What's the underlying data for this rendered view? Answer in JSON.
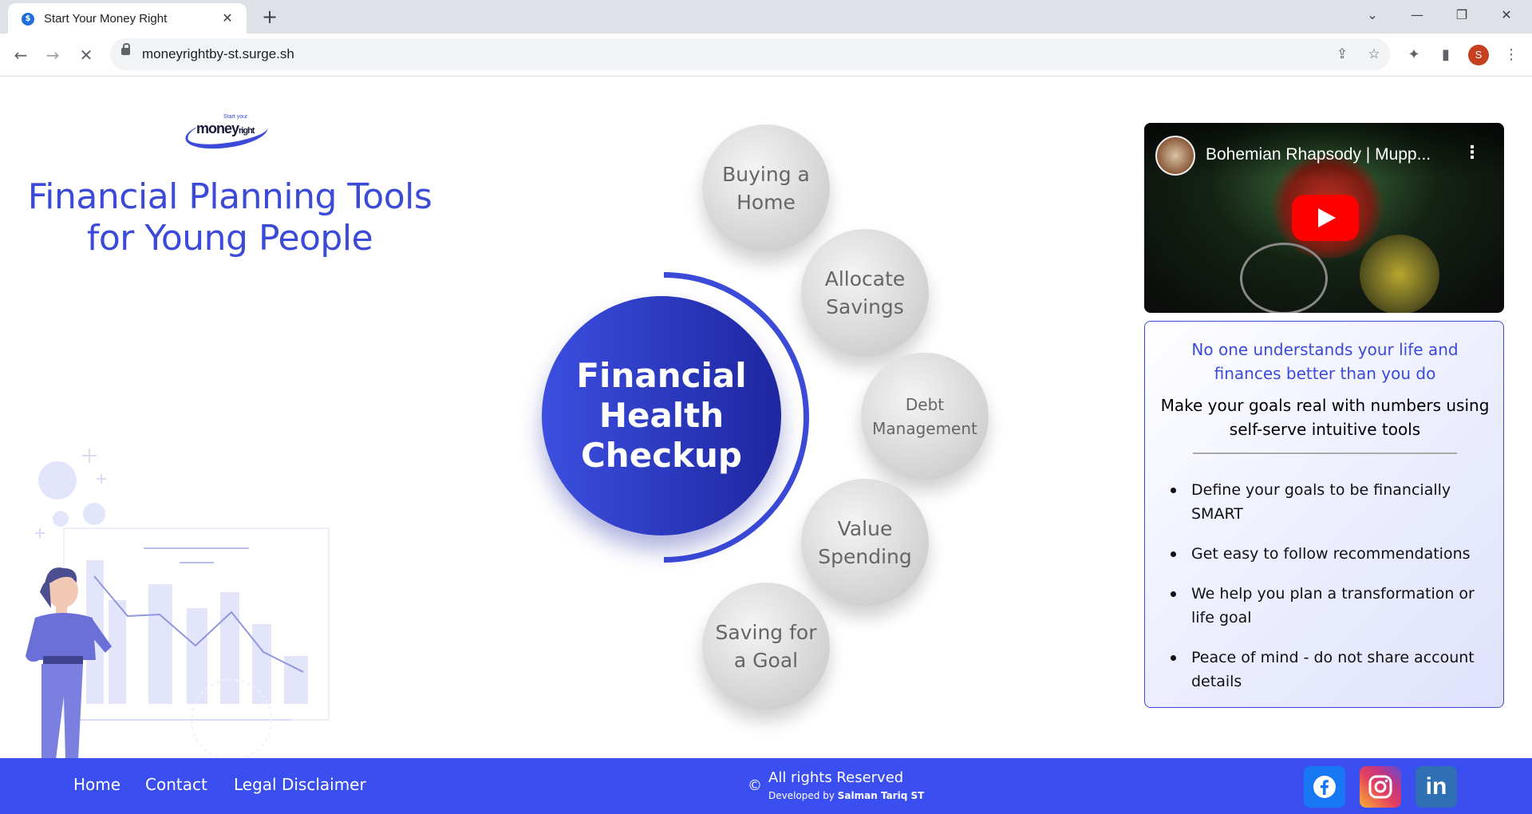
{
  "browser": {
    "tab_title": "Start Your Money Right",
    "tab_close": "✕",
    "new_tab": "+",
    "url": "moneyrightby-st.surge.sh",
    "profile_initial": "S",
    "controls": {
      "tab_search": "⌄",
      "minimize": "—",
      "restore": "❐",
      "close": "✕"
    }
  },
  "logo": {
    "tagline": "Start your",
    "word": "money",
    "word_suffix": "right"
  },
  "hero": {
    "title_line1": "Financial Planning Tools",
    "title_line2": "for Young People"
  },
  "wheel": {
    "center_label": "Financial Health Checkup",
    "items": [
      {
        "label": "Buying a Home"
      },
      {
        "label": "Allocate Savings"
      },
      {
        "label": "Debt Management"
      },
      {
        "label": "Value Spending"
      },
      {
        "label": "Saving for a Goal"
      }
    ]
  },
  "video": {
    "title": "Bohemian Rhapsody | Mupp..."
  },
  "card": {
    "lead": "No one understands your life and finances better than you do",
    "sub": "Make your goals real with numbers using self-serve intuitive tools",
    "bullets": [
      "Define your goals to be financially SMART",
      "Get easy to follow recommendations",
      "We help you plan a transformation or life goal",
      "Peace of mind - do not share account details"
    ]
  },
  "footer": {
    "links": [
      "Home",
      "Contact",
      "Legal Disclaimer"
    ],
    "copyright_symbol": "©",
    "copyright": "All rights Reserved",
    "developed_prefix": "Developed by",
    "developer": "Salman Tariq ST",
    "social": [
      {
        "icon": "facebook-icon",
        "color": "#1877f2"
      },
      {
        "icon": "instagram-icon",
        "color": "#d6249f"
      },
      {
        "icon": "linkedin-icon",
        "color": "#2f6fb3"
      }
    ]
  },
  "colors": {
    "accent": "#3b4ad7",
    "footer": "#3b4ff0"
  }
}
